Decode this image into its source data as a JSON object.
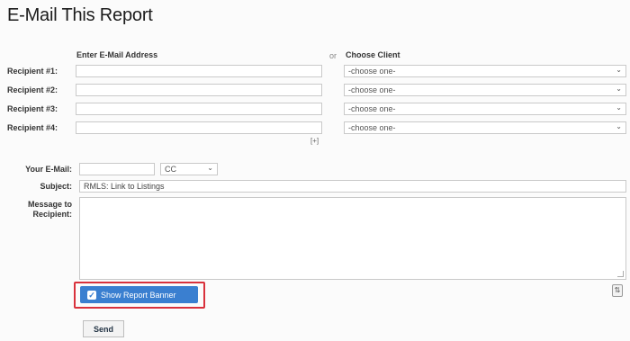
{
  "title": "E-Mail This Report",
  "headers": {
    "email": "Enter E-Mail Address",
    "or": "or",
    "client": "Choose Client"
  },
  "recipients": [
    {
      "label": "Recipient #1:",
      "email": "",
      "client": "-choose one-"
    },
    {
      "label": "Recipient #2:",
      "email": "",
      "client": "-choose one-"
    },
    {
      "label": "Recipient #3:",
      "email": "",
      "client": "-choose one-"
    },
    {
      "label": "Recipient #4:",
      "email": "",
      "client": "-choose one-"
    }
  ],
  "add_more": "[+]",
  "your_email": {
    "label": "Your E-Mail:",
    "value": "",
    "cc_option": "CC"
  },
  "subject": {
    "label": "Subject:",
    "value": "RMLS: Link to Listings"
  },
  "message": {
    "label": "Message to Recipient:",
    "value": ""
  },
  "banner": {
    "label": "Show Report Banner",
    "checked": true
  },
  "send": {
    "label": "Send"
  }
}
